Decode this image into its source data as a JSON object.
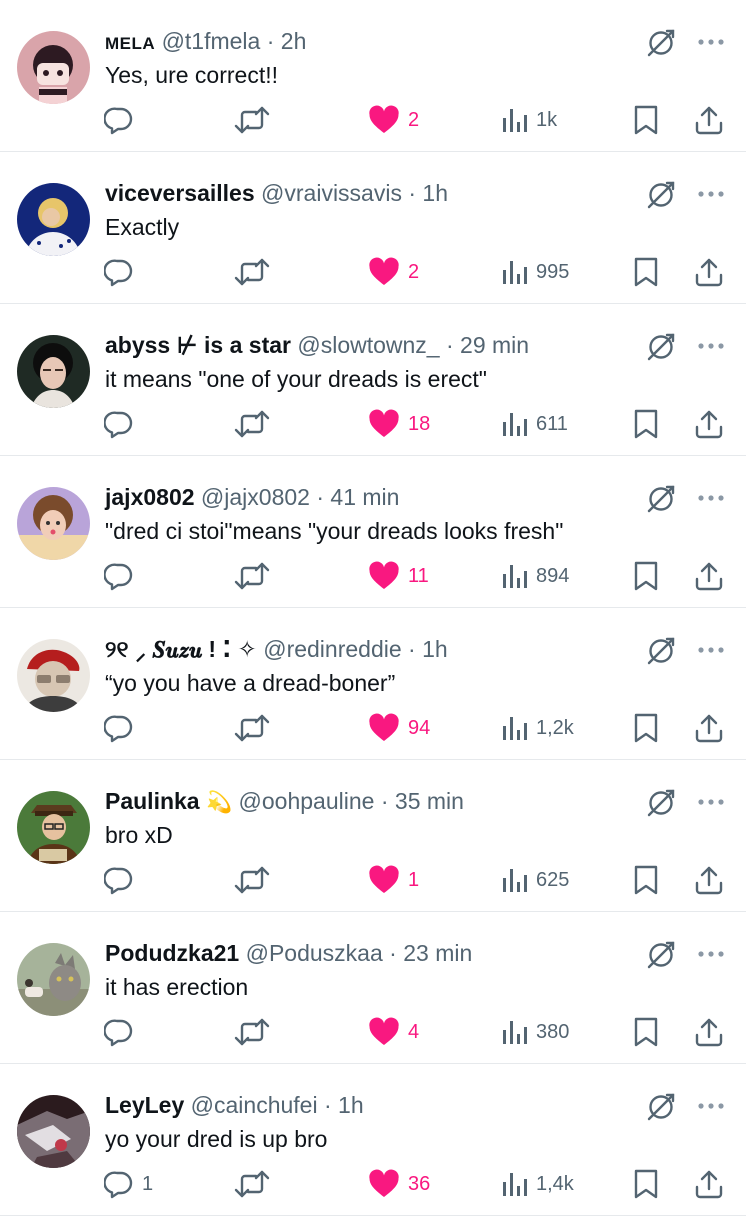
{
  "icons": {
    "reply": "reply-icon",
    "retweet": "retweet-icon",
    "like": "heart-icon",
    "views": "views-icon",
    "bookmark": "bookmark-icon",
    "share": "share-icon",
    "grok": "grok-icon",
    "more": "more-icon"
  },
  "colors": {
    "like": "#f91880",
    "muted": "#536471",
    "text": "#0f1419",
    "divider": "#e6e9ec"
  },
  "replies": [
    {
      "name": "MELA",
      "handle": "@t1fmela",
      "dot": "·",
      "time": "2h",
      "text": "Yes, ure correct!!",
      "reply_count": "",
      "likes": "2",
      "views": "1k"
    },
    {
      "name": "viceversailles",
      "handle": "@vraivissavis",
      "dot": "·",
      "time": "1h",
      "text": "Exactly",
      "reply_count": "",
      "likes": "2",
      "views": "995"
    },
    {
      "name": "abyss ⊬ is a star",
      "handle": "@slowtownz_",
      "dot": "·",
      "time": "29 min",
      "text": "it means \"one of your dreads is erect\"",
      "reply_count": "",
      "likes": "18",
      "views": "611"
    },
    {
      "name": "jajx0802",
      "handle": "@jajx0802",
      "dot": "·",
      "time": "41 min",
      "text": "\"dred ci stoi\"means \"your dreads looks fresh\"",
      "reply_count": "",
      "likes": "11",
      "views": "894"
    },
    {
      "name": "୨୧ ⸝ 𝑺𝒖𝒛𝒖 ! ⁚ ✧",
      "handle": "@redinreddie",
      "dot": "·",
      "time": "1h",
      "text": "“yo you have a dread-boner”",
      "reply_count": "",
      "likes": "94",
      "views": "1,2k"
    },
    {
      "name": "Paulinka",
      "emoji": "💫",
      "handle": "@oohpauline",
      "dot": "·",
      "time": "35 min",
      "text": "bro xD",
      "reply_count": "",
      "likes": "1",
      "views": "625"
    },
    {
      "name": "Podudzka21",
      "handle": "@Poduszkaa",
      "dot": "·",
      "time": "23 min",
      "text": "it has erection",
      "reply_count": "",
      "likes": "4",
      "views": "380"
    },
    {
      "name": "LeyLey",
      "handle": "@cainchufei",
      "dot": "·",
      "time": "1h",
      "text": "yo your dred is up bro",
      "reply_count": "1",
      "likes": "36",
      "views": "1,4k"
    }
  ]
}
